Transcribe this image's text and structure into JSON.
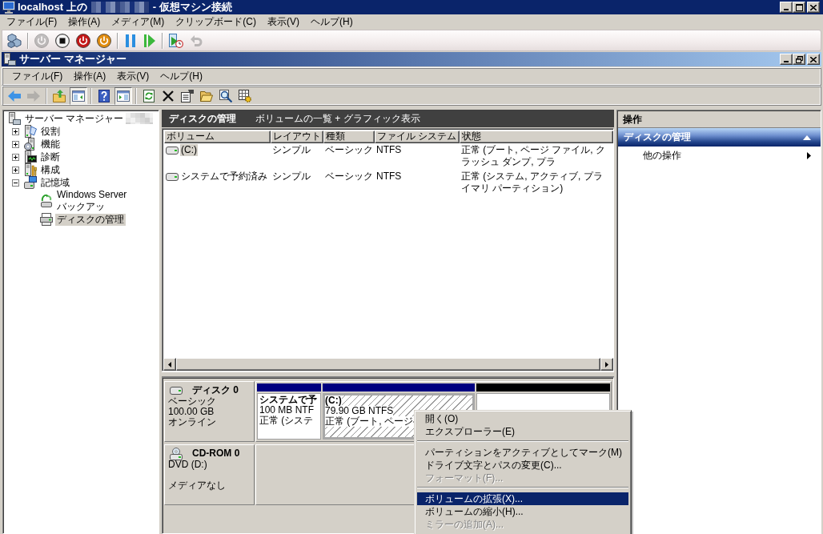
{
  "window": {
    "title_prefix": "localhost 上の",
    "title_suffix": "- 仮想マシン接続"
  },
  "menu_bar": [
    "ファイル(F)",
    "操作(A)",
    "メディア(M)",
    "クリップボード(C)",
    "表示(V)",
    "ヘルプ(H)"
  ],
  "vm_toolbar": [
    {
      "disabled": false
    },
    {
      "disabled": true
    },
    {
      "disabled": false
    },
    {
      "disabled": false
    },
    {
      "disabled": false
    },
    {
      "disabled": false
    },
    {
      "disabled": false
    },
    {
      "disabled": false
    },
    {
      "disabled": true
    }
  ],
  "server_manager": {
    "title": "サーバー マネージャー",
    "menu_bar": [
      "ファイル(F)",
      "操作(A)",
      "表示(V)",
      "ヘルプ(H)"
    ],
    "toolbar": [
      {
        "disabled": false,
        "pressed": false
      },
      {
        "disabled": true,
        "pressed": false
      },
      {
        "disabled": false,
        "pressed": false
      },
      {
        "disabled": false,
        "pressed": true
      },
      {
        "disabled": false,
        "pressed": false
      },
      {
        "disabled": false,
        "pressed": true
      },
      {
        "disabled": false,
        "pressed": false
      },
      {
        "disabled": false,
        "pressed": false
      },
      {
        "disabled": false,
        "pressed": false
      },
      {
        "disabled": false,
        "pressed": false
      },
      {
        "disabled": false,
        "pressed": false
      },
      {
        "disabled": false,
        "pressed": false
      }
    ],
    "tree": {
      "label": "サーバー マネージャー",
      "selected": false,
      "children": [
        {
          "label": "役割",
          "expanded": false,
          "selected": false
        },
        {
          "label": "機能",
          "expanded": false,
          "selected": false
        },
        {
          "label": "診断",
          "expanded": false,
          "selected": false
        },
        {
          "label": "構成",
          "expanded": false,
          "selected": false
        },
        {
          "label": "記憶域",
          "expanded": true,
          "selected": false,
          "children": [
            {
              "label": "Windows Server バックアッ",
              "selected": false
            },
            {
              "label": "ディスクの管理",
              "selected": true
            }
          ]
        }
      ]
    },
    "center": {
      "title": "ディスクの管理",
      "subtitle": "ボリュームの一覧 + グラフィック表示",
      "volume_table": {
        "columns": [
          "ボリューム",
          "レイアウト",
          "種類",
          "ファイル システム",
          "状態"
        ],
        "rows": [
          {
            "cells": [
              "(C:)",
              "シンプル",
              "ベーシック",
              "NTFS",
              "正常 (ブート, ページ ファイル, クラッシュ ダンプ, プラ"
            ],
            "selected": true
          },
          {
            "cells": [
              "システムで予約済み",
              "シンプル",
              "ベーシック",
              "NTFS",
              "正常 (システム, アクティブ, プライマリ パーティション)"
            ],
            "selected": false
          }
        ]
      },
      "disks": [
        {
          "kind": "disk",
          "label": "ディスク 0",
          "type": "ベーシック",
          "size": "100.00 GB",
          "status": "オンライン",
          "partitions": [
            {
              "kind": "primary",
              "name": "システムで予",
              "size": "100 MB NTF",
              "status": "正常 (システ",
              "selected": false
            },
            {
              "kind": "primary",
              "name": "(C:)",
              "size": "79.90 GB NTFS",
              "status": "正常 (ブート, ページ",
              "selected": true
            },
            {
              "kind": "unallocated",
              "selected": false
            }
          ]
        },
        {
          "kind": "cdrom",
          "label": "CD-ROM 0",
          "type": "DVD (D:)",
          "status": "メディアなし"
        }
      ]
    },
    "actions": {
      "title": "操作",
      "sections": [
        {
          "title": "ディスクの管理",
          "expanded": true,
          "items": [
            {
              "label": "他の操作",
              "submenu": true
            }
          ]
        }
      ]
    }
  },
  "context_menu": [
    {
      "kind": "item",
      "label": "開く(O)",
      "disabled": false,
      "selected": false
    },
    {
      "kind": "item",
      "label": "エクスプローラー(E)",
      "disabled": false,
      "selected": false
    },
    {
      "kind": "separator"
    },
    {
      "kind": "item",
      "label": "パーティションをアクティブとしてマーク(M)",
      "disabled": false,
      "selected": false
    },
    {
      "kind": "item",
      "label": "ドライブ文字とパスの変更(C)...",
      "disabled": false,
      "selected": false
    },
    {
      "kind": "item",
      "label": "フォーマット(F)...",
      "disabled": true,
      "selected": false
    },
    {
      "kind": "separator"
    },
    {
      "kind": "item",
      "label": "ボリュームの拡張(X)...",
      "disabled": false,
      "selected": true
    },
    {
      "kind": "item",
      "label": "ボリュームの縮小(H)...",
      "disabled": false,
      "selected": false
    },
    {
      "kind": "item",
      "label": "ミラーの追加(A)...",
      "disabled": true,
      "selected": false
    }
  ]
}
